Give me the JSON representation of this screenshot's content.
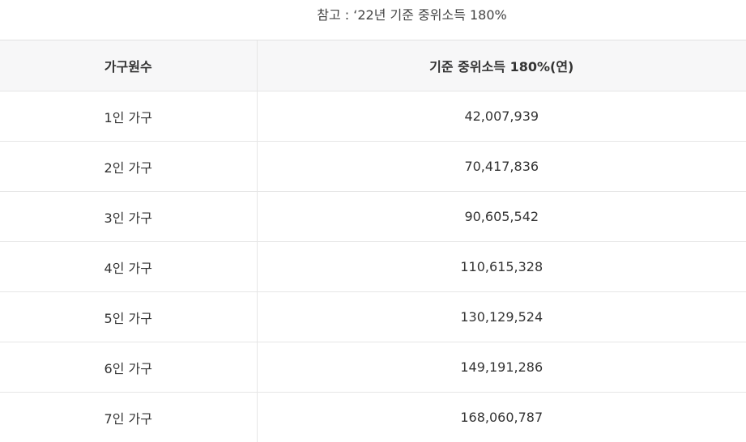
{
  "note": "참고 : ‘22년 기준 중위소득 180%",
  "table": {
    "headers": [
      "가구원수",
      "기준 중위소득 180%(연)"
    ],
    "rows": [
      [
        "1인 가구",
        "42,007,939"
      ],
      [
        "2인 가구",
        "70,417,836"
      ],
      [
        "3인 가구",
        "90,605,542"
      ],
      [
        "4인 가구",
        "110,615,328"
      ],
      [
        "5인 가구",
        "130,129,524"
      ],
      [
        "6인 가구",
        "149,191,286"
      ],
      [
        "7인 가구",
        "168,060,787"
      ]
    ]
  }
}
